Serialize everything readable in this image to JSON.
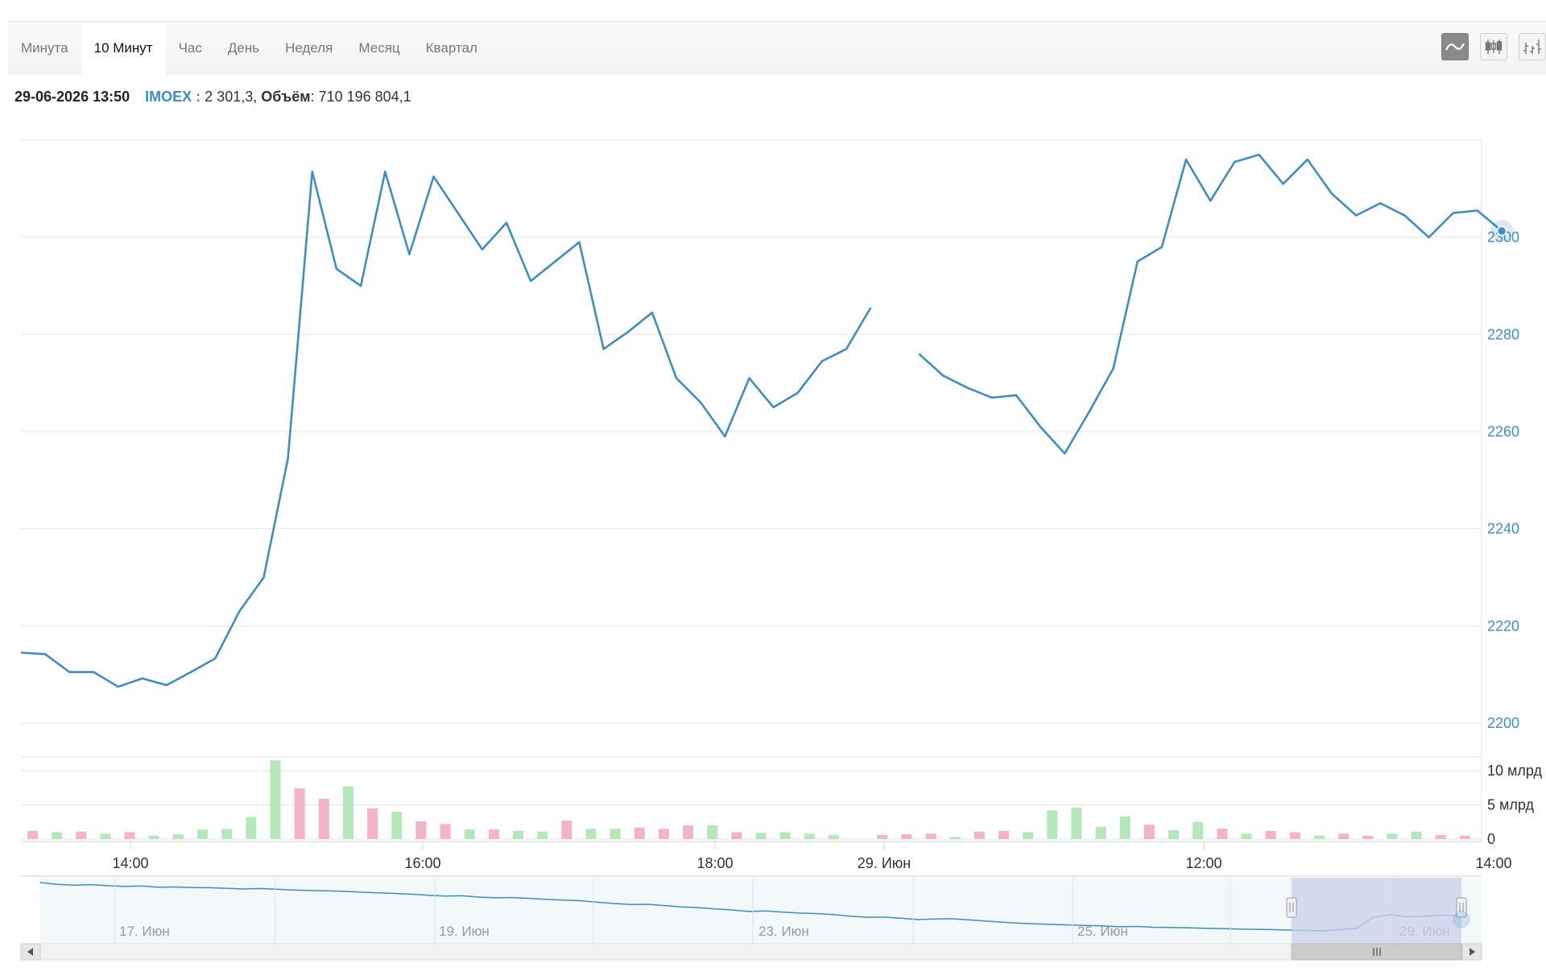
{
  "tabs": [
    {
      "label": "Минута",
      "active": false
    },
    {
      "label": "10 Минут",
      "active": true
    },
    {
      "label": "Час",
      "active": false
    },
    {
      "label": "День",
      "active": false
    },
    {
      "label": "Неделя",
      "active": false
    },
    {
      "label": "Месяц",
      "active": false
    },
    {
      "label": "Квартал",
      "active": false
    }
  ],
  "tools": [
    {
      "icon": "line-chart-icon",
      "active": true
    },
    {
      "icon": "candlestick-icon",
      "active": false
    },
    {
      "icon": "ohlc-bars-icon",
      "active": false
    }
  ],
  "info": {
    "datetime": "29-06-2026 13:50",
    "symbol": "IMOEX :",
    "value": "2 301,3,",
    "volume_label": "Объём",
    "volume_value": ": 710 196 804,1"
  },
  "colors": {
    "line": "#3d8fc0",
    "axis_text": "#3d8fc0",
    "volume_up": "#b5e8b9",
    "volume_down": "#f3b3c8",
    "navigator_mask": "#c9d2ea",
    "grid": "#e6e6e6"
  },
  "chart_data": {
    "type": "line",
    "series": [
      {
        "name": "IMOEX",
        "segments": [
          [
            2214.5,
            2214.2,
            2210.5,
            2210.5,
            2207.5,
            2209.2,
            2207.8,
            2210.5,
            2213.3,
            2223.0,
            2230.0,
            2254.5,
            2313.5,
            2293.5,
            2290.0,
            2313.5,
            2296.5,
            2312.5,
            2305.0,
            2297.5,
            2303.0,
            2291.0,
            2295.0,
            2299.0,
            2277.0,
            2280.5,
            2284.5,
            2271.0,
            2266.0,
            2259.0,
            2271.0,
            2265.0,
            2268.0,
            2274.5,
            2277.0,
            2285.5
          ],
          [
            2276.0,
            2271.5,
            2269.0,
            2267.0,
            2267.5,
            2261.0,
            2255.5,
            2264.0,
            2273.0,
            2295.0,
            2298.0,
            2316.0,
            2307.5,
            2315.5,
            2317.0,
            2311.0,
            2316.0,
            2309.0,
            2304.5,
            2307.0,
            2304.5,
            2300.0,
            2305.0,
            2305.5,
            2301.3
          ]
        ]
      }
    ],
    "volume": [
      {
        "value": 1.2,
        "dir": "down"
      },
      {
        "value": 1.0,
        "dir": "up"
      },
      {
        "value": 1.1,
        "dir": "down"
      },
      {
        "value": 0.8,
        "dir": "up"
      },
      {
        "value": 1.0,
        "dir": "down"
      },
      {
        "value": 0.5,
        "dir": "up"
      },
      {
        "value": 0.7,
        "dir": "up"
      },
      {
        "value": 1.4,
        "dir": "up"
      },
      {
        "value": 1.5,
        "dir": "up"
      },
      {
        "value": 3.2,
        "dir": "up"
      },
      {
        "value": 11.5,
        "dir": "up"
      },
      {
        "value": 7.4,
        "dir": "down"
      },
      {
        "value": 5.9,
        "dir": "down"
      },
      {
        "value": 7.7,
        "dir": "up"
      },
      {
        "value": 4.5,
        "dir": "down"
      },
      {
        "value": 4.0,
        "dir": "up"
      },
      {
        "value": 2.6,
        "dir": "down"
      },
      {
        "value": 2.2,
        "dir": "down"
      },
      {
        "value": 1.4,
        "dir": "up"
      },
      {
        "value": 1.4,
        "dir": "down"
      },
      {
        "value": 1.2,
        "dir": "up"
      },
      {
        "value": 1.1,
        "dir": "up"
      },
      {
        "value": 2.7,
        "dir": "down"
      },
      {
        "value": 1.5,
        "dir": "up"
      },
      {
        "value": 1.5,
        "dir": "up"
      },
      {
        "value": 1.7,
        "dir": "down"
      },
      {
        "value": 1.5,
        "dir": "down"
      },
      {
        "value": 2.0,
        "dir": "down"
      },
      {
        "value": 2.0,
        "dir": "up"
      },
      {
        "value": 1.0,
        "dir": "down"
      },
      {
        "value": 0.9,
        "dir": "up"
      },
      {
        "value": 1.0,
        "dir": "up"
      },
      {
        "value": 0.8,
        "dir": "up"
      },
      {
        "value": 0.6,
        "dir": "up"
      },
      {
        "value": null,
        "dir": "up"
      },
      {
        "value": 0.6,
        "dir": "down"
      },
      {
        "value": 0.7,
        "dir": "down"
      },
      {
        "value": 0.8,
        "dir": "down"
      },
      {
        "value": 0.3,
        "dir": "up"
      },
      {
        "value": 1.1,
        "dir": "down"
      },
      {
        "value": 1.2,
        "dir": "down"
      },
      {
        "value": 1.0,
        "dir": "up"
      },
      {
        "value": 4.2,
        "dir": "up"
      },
      {
        "value": 4.6,
        "dir": "up"
      },
      {
        "value": 1.8,
        "dir": "up"
      },
      {
        "value": 3.3,
        "dir": "up"
      },
      {
        "value": 2.1,
        "dir": "down"
      },
      {
        "value": 1.3,
        "dir": "up"
      },
      {
        "value": 2.5,
        "dir": "up"
      },
      {
        "value": 1.5,
        "dir": "down"
      },
      {
        "value": 0.8,
        "dir": "up"
      },
      {
        "value": 1.2,
        "dir": "down"
      },
      {
        "value": 1.0,
        "dir": "down"
      },
      {
        "value": 0.5,
        "dir": "up"
      },
      {
        "value": 0.8,
        "dir": "down"
      },
      {
        "value": 0.5,
        "dir": "down"
      },
      {
        "value": 0.8,
        "dir": "up"
      },
      {
        "value": 1.1,
        "dir": "up"
      },
      {
        "value": 0.6,
        "dir": "down"
      },
      {
        "value": 0.5,
        "dir": "down"
      }
    ],
    "y_ticks": [
      2200,
      2220,
      2240,
      2260,
      2280,
      2300
    ],
    "ylim": [
      2200,
      2320
    ],
    "volume_ticks": [
      {
        "value": 0,
        "label": "0"
      },
      {
        "value": 5,
        "label": "5 млрд"
      },
      {
        "value": 10,
        "label": "10 млрд"
      }
    ],
    "volume_max": 12,
    "x_ticks": [
      "14:00",
      "16:00",
      "18:00",
      "29. Июн",
      "12:00",
      "14:00"
    ],
    "navigator": {
      "date_labels": [
        "17. Июн",
        "19. Июн",
        "23. Июн",
        "25. Июн",
        "29. Июн"
      ],
      "values": [
        2430,
        2423,
        2420,
        2422,
        2418,
        2415,
        2417,
        2412,
        2413,
        2411,
        2410,
        2408,
        2405,
        2407,
        2404,
        2401,
        2399,
        2398,
        2396,
        2393,
        2390,
        2388,
        2385,
        2381,
        2378,
        2379,
        2374,
        2371,
        2372,
        2369,
        2365,
        2362,
        2360,
        2354,
        2349,
        2345,
        2346,
        2341,
        2336,
        2333,
        2328,
        2324,
        2318,
        2320,
        2316,
        2312,
        2310,
        2306,
        2300,
        2296,
        2296,
        2292,
        2287,
        2289,
        2290,
        2286,
        2281,
        2277,
        2273,
        2270,
        2268,
        2266,
        2264,
        2262,
        2259,
        2260,
        2257,
        2256,
        2255,
        2253,
        2252,
        2250,
        2249,
        2248,
        2246,
        2245,
        2243,
        2248,
        2252,
        2295,
        2306,
        2298,
        2300,
        2304,
        2301
      ]
    }
  }
}
